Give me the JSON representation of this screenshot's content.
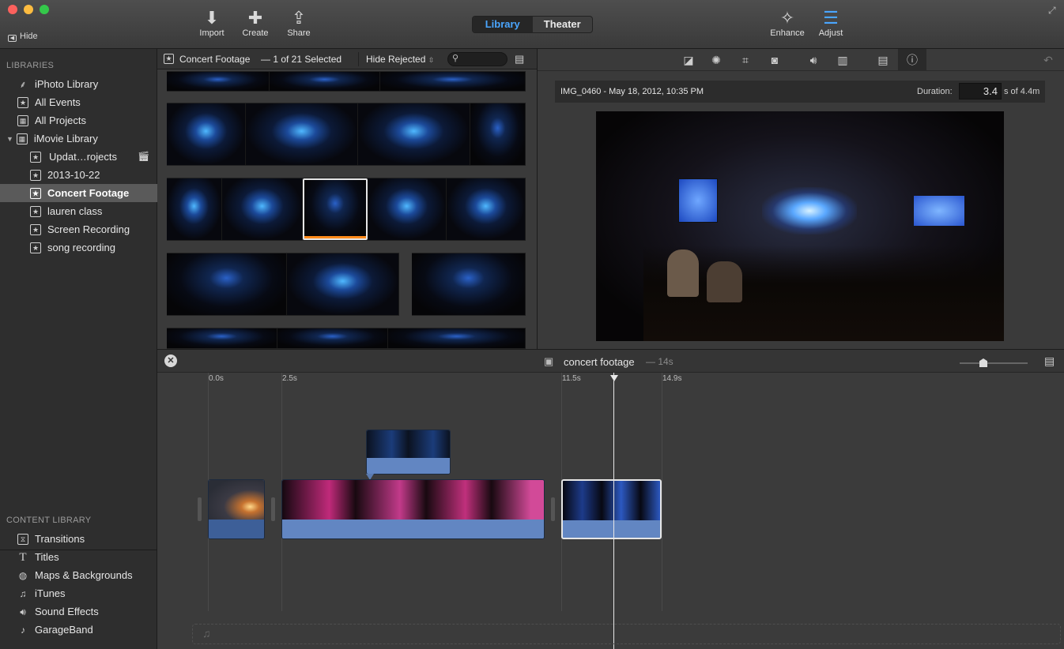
{
  "toolbar": {
    "hide_label": "Hide",
    "import_label": "Import",
    "create_label": "Create",
    "share_label": "Share",
    "library_tab": "Library",
    "theater_tab": "Theater",
    "enhance_label": "Enhance",
    "adjust_label": "Adjust",
    "colors": {
      "accent": "#4aa6ff",
      "close": "#fc615d",
      "minimize": "#fdbc40",
      "zoom": "#34c84a"
    }
  },
  "sidebar": {
    "libraries_heading": "LIBRARIES",
    "items": [
      {
        "label": "iPhoto Library",
        "icon": "palm-tree-icon"
      },
      {
        "label": "All Events",
        "icon": "star-box-icon"
      },
      {
        "label": "All Projects",
        "icon": "grid-icon"
      },
      {
        "label": "iMovie Library",
        "icon": "grid-icon"
      },
      {
        "label": "Updat…rojects",
        "icon": "star-box-icon"
      },
      {
        "label": "2013-10-22",
        "icon": "star-box-icon"
      },
      {
        "label": "Concert Footage",
        "icon": "star-box-icon",
        "selected": true
      },
      {
        "label": "lauren class",
        "icon": "star-box-icon"
      },
      {
        "label": "Screen Recording",
        "icon": "star-box-icon"
      },
      {
        "label": "song recording",
        "icon": "star-box-icon"
      }
    ],
    "content_heading": "CONTENT LIBRARY",
    "content_items": [
      {
        "label": "Transitions",
        "icon": "transitions-icon"
      },
      {
        "label": "Titles",
        "icon": "titles-icon"
      },
      {
        "label": "Maps & Backgrounds",
        "icon": "globe-icon"
      },
      {
        "label": "iTunes",
        "icon": "music-note-icon"
      },
      {
        "label": "Sound Effects",
        "icon": "speaker-icon"
      },
      {
        "label": "GarageBand",
        "icon": "guitar-icon"
      }
    ]
  },
  "browser": {
    "event_title": "Concert Footage",
    "selection_text": "— 1 of 21 Selected",
    "filter_label": "Hide Rejected",
    "search_placeholder": ""
  },
  "viewer": {
    "clip_name": "IMG_0460 - May 18, 2012, 10:35 PM",
    "duration_label": "Duration:",
    "duration_value": "3.4",
    "duration_suffix": "s of 4.4m"
  },
  "timeline": {
    "project_name": "concert footage",
    "project_length": "— 14s",
    "ruler": [
      "0.0s",
      "2.5s",
      "11.5s",
      "14.9s"
    ]
  }
}
